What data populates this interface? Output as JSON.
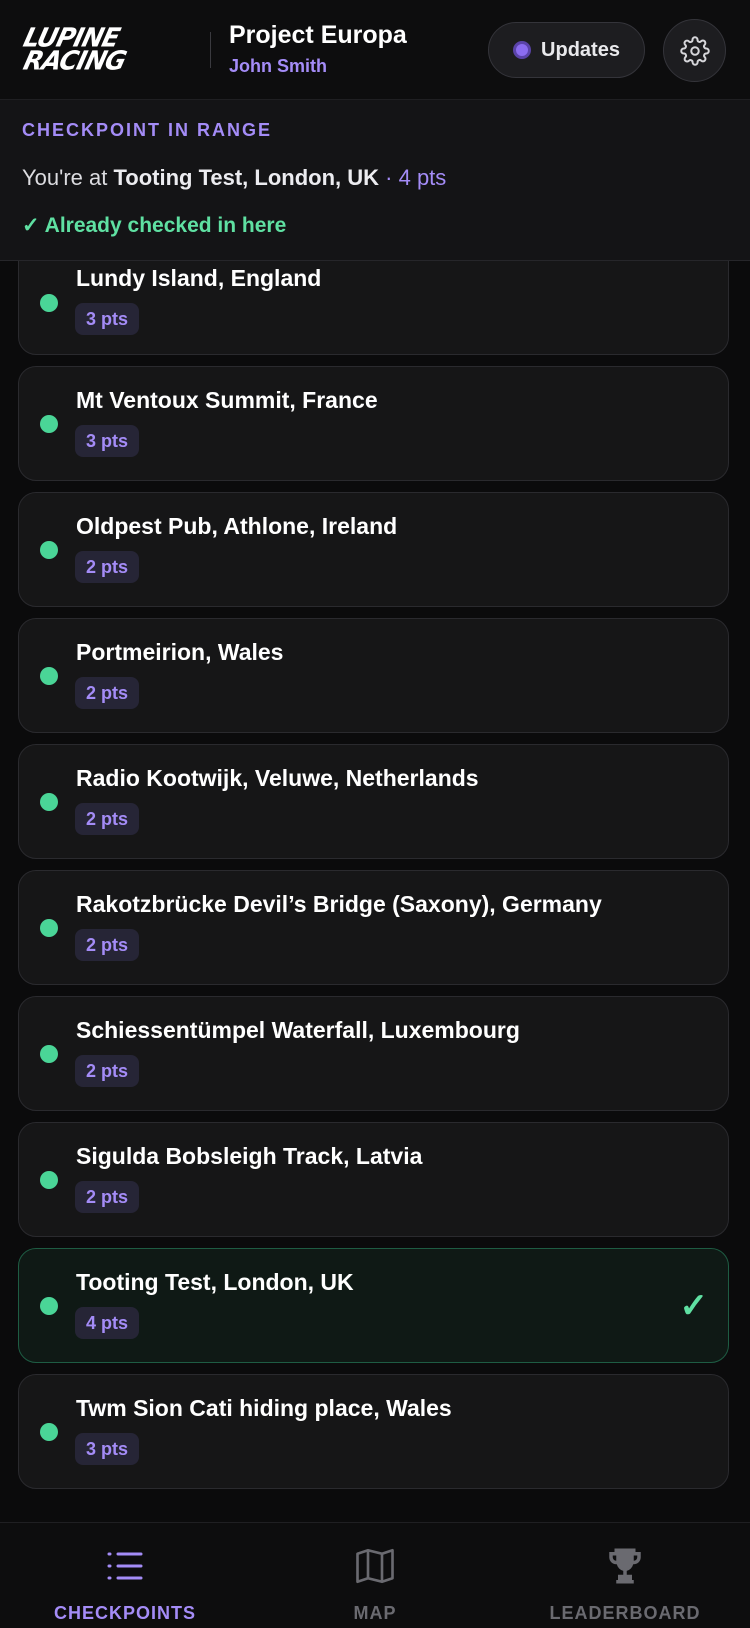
{
  "header": {
    "logo_line1": "Lupine",
    "logo_line2": "Racing",
    "project_title": "Project Europa",
    "user_name": "John Smith",
    "updates_label": "Updates",
    "settings_icon": "gear-icon"
  },
  "range": {
    "heading": "CHECKPOINT IN RANGE",
    "prefix": "You're at ",
    "location": "Tooting Test, London, UK",
    "points": " · 4 pts",
    "status": "✓ Already checked in here"
  },
  "checkpoints": [
    {
      "name": "Lundy Island, England",
      "points": "3 pts"
    },
    {
      "name": "Mt Ventoux Summit, France",
      "points": "3 pts"
    },
    {
      "name": "Oldpest Pub, Athlone, Ireland",
      "points": "2 pts"
    },
    {
      "name": "Portmeirion, Wales",
      "points": "2 pts"
    },
    {
      "name": "Radio Kootwijk, Veluwe, Netherlands",
      "points": "2 pts"
    },
    {
      "name": "Rakotzbrücke Devil’s Bridge (Saxony), Germany",
      "points": "2 pts"
    },
    {
      "name": "Schiessentümpel Waterfall, Luxembourg",
      "points": "2 pts"
    },
    {
      "name": "Sigulda Bobsleigh Track, Latvia",
      "points": "2 pts"
    },
    {
      "name": "Tooting Test, London, UK",
      "points": "4 pts",
      "checked": "✓"
    },
    {
      "name": "Twm Sion Cati hiding place, Wales",
      "points": "3 pts"
    }
  ],
  "nav": {
    "checkpoints": "CHECKPOINTS",
    "map": "MAP",
    "leaderboard": "LEADERBOARD",
    "active": "checkpoints"
  },
  "colors": {
    "accent": "#a48cf7",
    "success": "#5fe0a2",
    "dot": "#4ad597",
    "background": "#0b0b0c"
  }
}
